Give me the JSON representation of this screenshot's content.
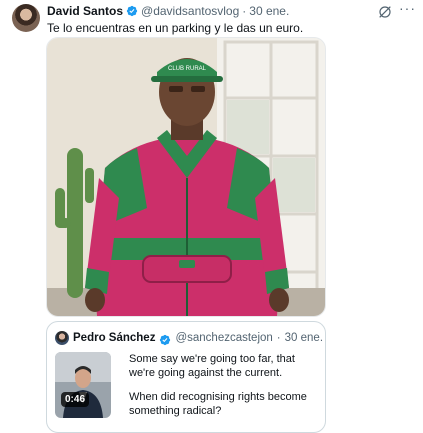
{
  "tweet": {
    "author_name": "David Santos",
    "handle": "@davidsantosvlog",
    "separator": "·",
    "date": "30 ene.",
    "text": "Te lo encuentras en un parking y le das un euro.",
    "more_icon": "more-icon",
    "grok_icon": "grok-icon",
    "cap_text": "CLUB RURAL"
  },
  "quoted": {
    "author_name": "Pedro Sánchez",
    "handle": "@sanchezcastejon",
    "separator": "·",
    "date": "30 ene.",
    "video_duration": "0:46",
    "paragraph_1": "Some say we're going too far, that we're going against the current.",
    "paragraph_2": "When did recognising rights become something radical?"
  },
  "colors": {
    "verified": "#1d9bf0",
    "secondary_text": "#536471",
    "border": "#cfd9de"
  }
}
